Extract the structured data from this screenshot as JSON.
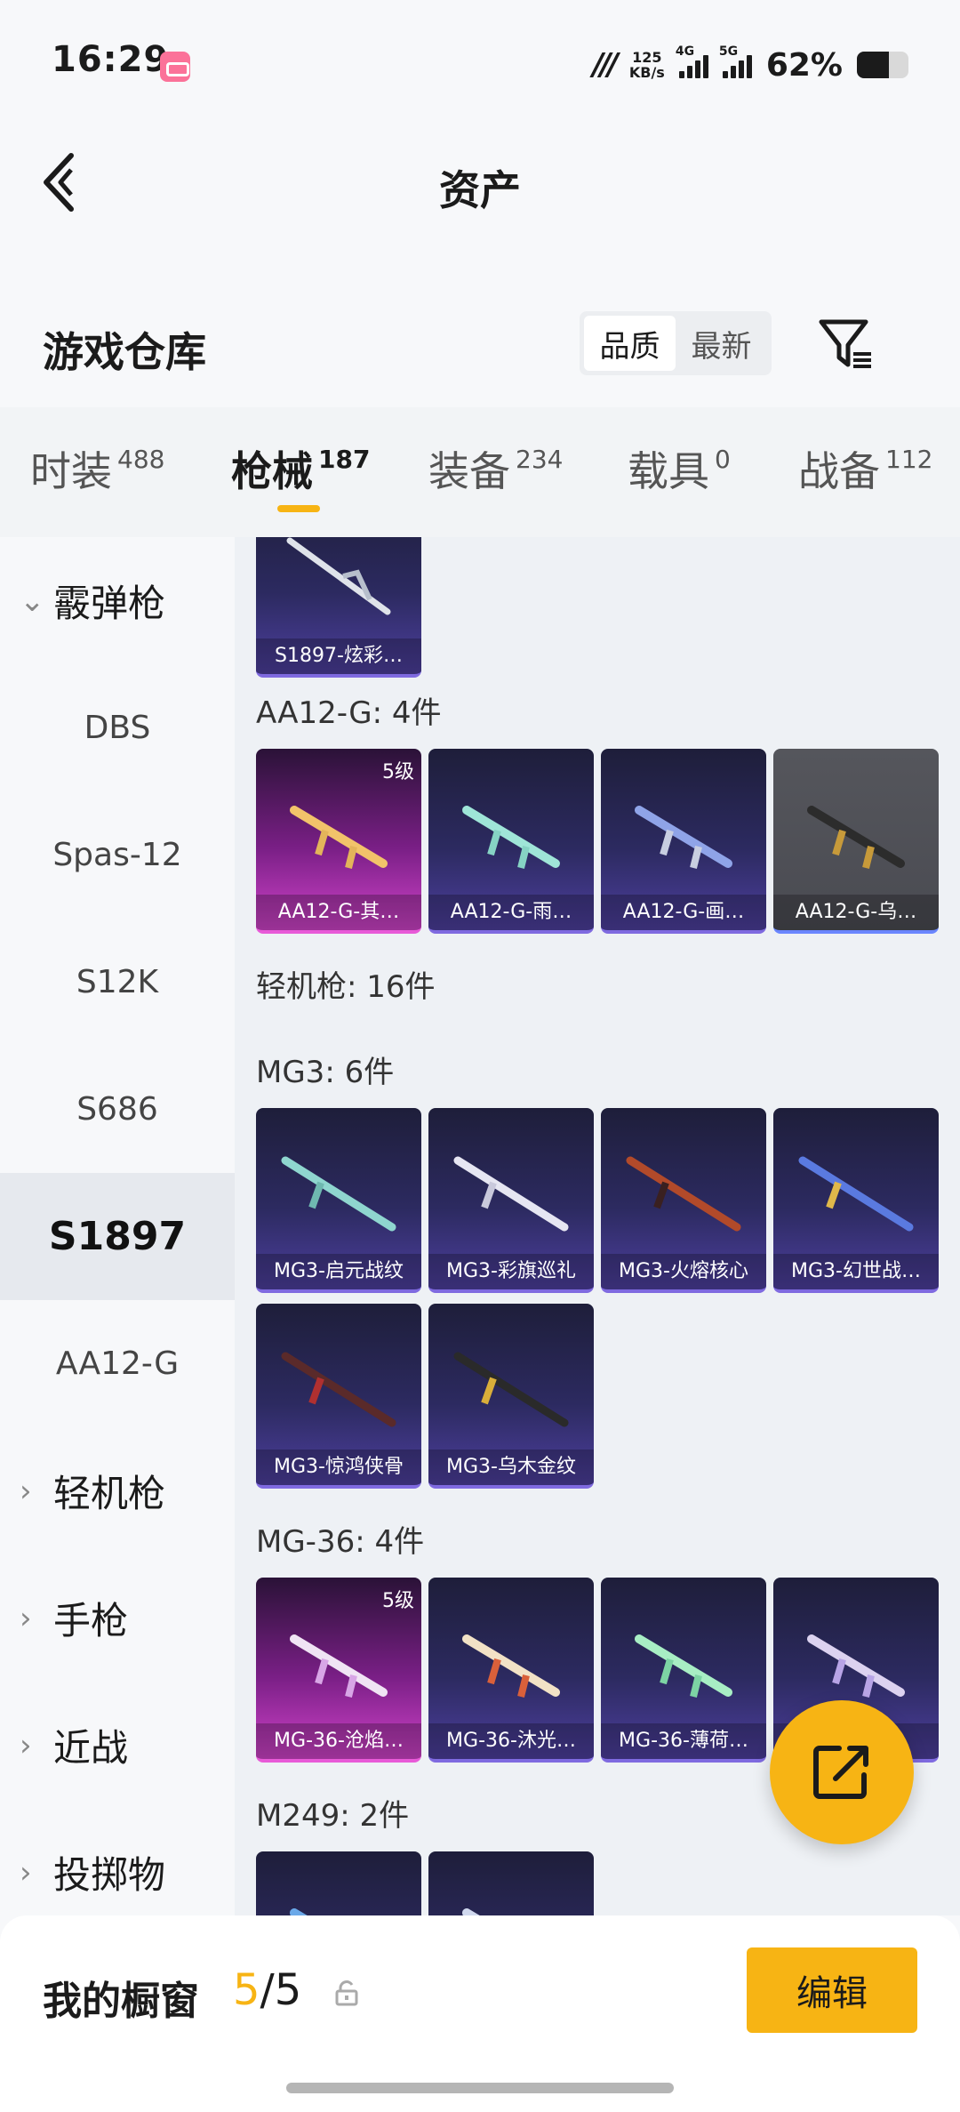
{
  "status_bar": {
    "time": "16:29",
    "app_icon": "bilibili-icon",
    "net_speed_value": "125",
    "net_speed_unit": "KB/s",
    "sim1": "4G",
    "sim2": "5G",
    "battery": "62%",
    "battery_level": 0.62
  },
  "header": {
    "title": "资产"
  },
  "warehouse": {
    "title": "游戏仓库",
    "sort_options": [
      "品质",
      "最新"
    ],
    "active_sort": "品质"
  },
  "tabs": [
    {
      "label": "时装",
      "count": "488"
    },
    {
      "label": "枪械",
      "count": "187"
    },
    {
      "label": "装备",
      "count": "234"
    },
    {
      "label": "载具",
      "count": "0"
    },
    {
      "label": "战备",
      "count": "112"
    }
  ],
  "active_tab": "枪械",
  "sidebar": {
    "category_shotgun": "霰弹枪",
    "sub_items": [
      "DBS",
      "Spas-12",
      "S12K",
      "S686",
      "S1897",
      "AA12-G"
    ],
    "selected": "S1897",
    "categories": [
      "轻机枪",
      "手枪",
      "近战",
      "投掷物"
    ]
  },
  "content": {
    "top_card_name": "S1897-炫彩…",
    "sections": [
      {
        "label": "AA12-G: 4件",
        "items": [
          {
            "name": "AA12-G-其…",
            "tier": "5级",
            "rarity": "pink"
          },
          {
            "name": "AA12-G-雨…",
            "rarity": "purple"
          },
          {
            "name": "AA12-G-画…",
            "rarity": "purple"
          },
          {
            "name": "AA12-G-乌…",
            "rarity": "gray"
          }
        ]
      },
      {
        "label": "轻机枪: 16件"
      },
      {
        "label": "MG3: 6件",
        "items": [
          {
            "name": "MG3-启元战纹",
            "rarity": "purple"
          },
          {
            "name": "MG3-彩旗巡礼",
            "rarity": "purple"
          },
          {
            "name": "MG3-火熔核心",
            "rarity": "purple"
          },
          {
            "name": "MG3-幻世战…",
            "rarity": "purple"
          },
          {
            "name": "MG3-惊鸿侠骨",
            "rarity": "purple"
          },
          {
            "name": "MG3-乌木金纹",
            "rarity": "purple"
          }
        ]
      },
      {
        "label": "MG-36: 4件",
        "items": [
          {
            "name": "MG-36-沧焰…",
            "tier": "5级",
            "rarity": "pink"
          },
          {
            "name": "MG-36-沐光…",
            "rarity": "purple"
          },
          {
            "name": "MG-36-薄荷…",
            "rarity": "purple"
          },
          {
            "name": "",
            "rarity": "purple"
          }
        ]
      },
      {
        "label": "M249: 2件"
      }
    ]
  },
  "bottom_bar": {
    "title": "我的橱窗",
    "current": "5",
    "separator": "/",
    "total": "5",
    "edit_label": "编辑"
  },
  "colors": {
    "accent": "#f7b414",
    "purple_card": "#2c2a60",
    "pink_card": "#cf43c9"
  }
}
